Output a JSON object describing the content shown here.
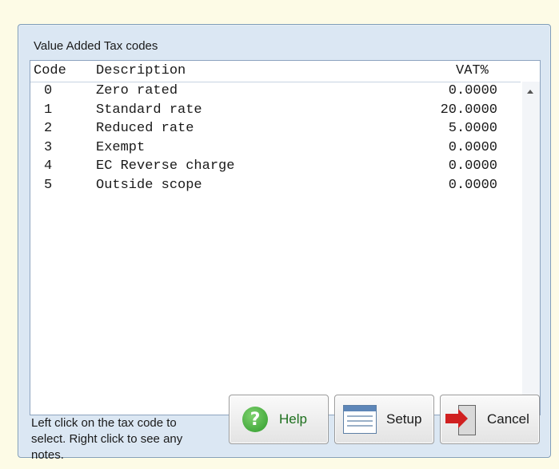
{
  "window": {
    "title": "Value Added Tax codes"
  },
  "columns": {
    "code": "Code",
    "description": "Description",
    "vat": "VAT%"
  },
  "rows": [
    {
      "code": "0",
      "description": "Zero rated",
      "vat": "0.0000"
    },
    {
      "code": "1",
      "description": "Standard rate",
      "vat": "20.0000"
    },
    {
      "code": "2",
      "description": "Reduced rate",
      "vat": "5.0000"
    },
    {
      "code": "3",
      "description": "Exempt",
      "vat": "0.0000"
    },
    {
      "code": "4",
      "description": "EC Reverse charge",
      "vat": "0.0000"
    },
    {
      "code": "5",
      "description": "Outside scope",
      "vat": "0.0000"
    }
  ],
  "hint": {
    "line1": "Left click on the tax code to",
    "line2": "select.  Right click to see any",
    "line3": "notes."
  },
  "buttons": {
    "help": {
      "label": "Help",
      "icon": "help-icon"
    },
    "setup": {
      "label": "Setup",
      "icon": "setup-icon"
    },
    "cancel": {
      "label": "Cancel",
      "icon": "exit-door-icon"
    }
  },
  "colors": {
    "background": "#fdfbe6",
    "window": "#dbe7f3",
    "help_text": "#1d6f1d",
    "cancel_arrow": "#d02020"
  }
}
